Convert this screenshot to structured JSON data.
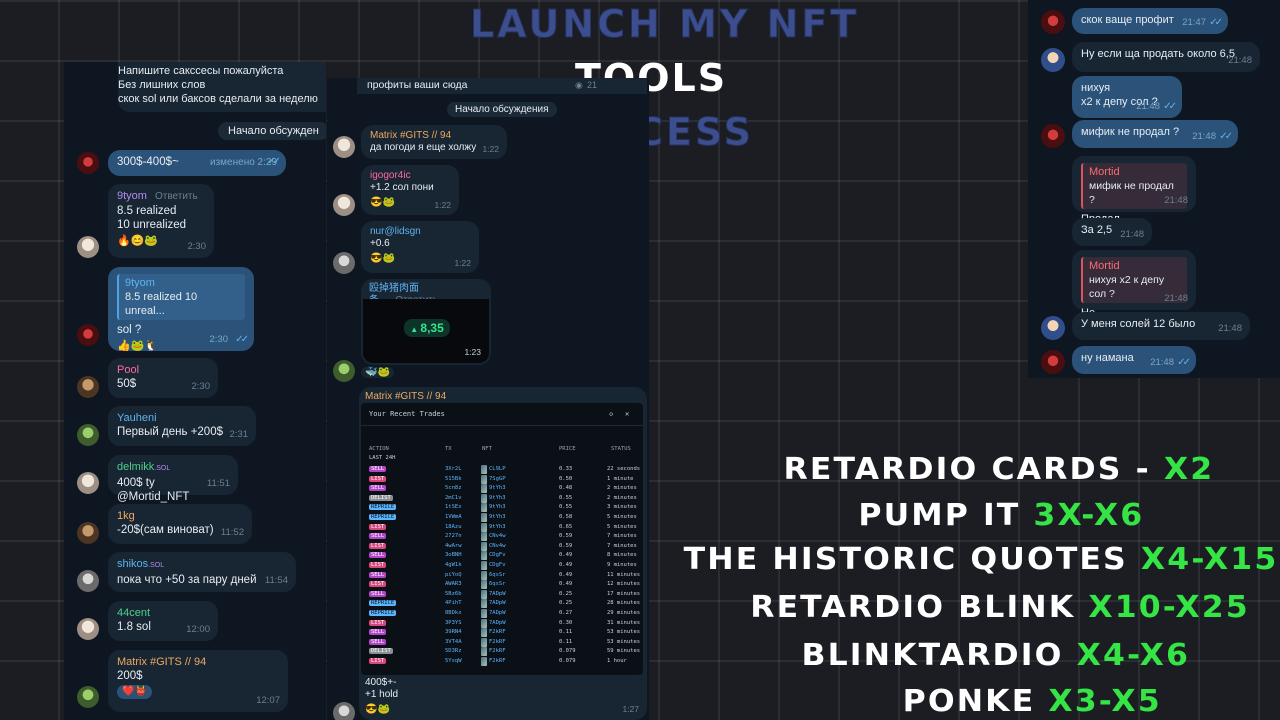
{
  "titles": {
    "line1": "Launch my NFT",
    "line2": "Tools",
    "line3": "Success"
  },
  "colors": {
    "accent_green": "#35e545",
    "bubble_in": "#182533",
    "bubble_out": "#2b5278",
    "title_blue": "#3d4e8e"
  },
  "left_chat": {
    "pinned_lines": [
      "Напишите сакссесы пожалуйста",
      "Без лишних слов",
      "скок sol или баксов сделали за неделю"
    ],
    "discussion_label": "Начало обсужден",
    "messages": [
      {
        "sender": "",
        "text": "300$-400$~",
        "edited": "изменено 2:29",
        "time": ""
      },
      {
        "sender": "9tyom",
        "reply": "Ответить",
        "text1": "8.5 realized",
        "text2": "10 unrealized",
        "emoji": "🔥😊🐸",
        "time": "2:30"
      },
      {
        "quote_name": "9tyom",
        "quote_text": "8.5 realized 10 unreal...",
        "text": "sol ?",
        "emoji": "👍🐸🐧",
        "time": "2:30"
      },
      {
        "sender": "Pool",
        "text": "50$",
        "time": "2:30"
      },
      {
        "sender": "Yauheni",
        "text": "Первый день +200$",
        "time": "2:31"
      },
      {
        "sender": "delmikk",
        "badge": ".SOL",
        "text": "400$ ty @Mortid_NFT",
        "time": "11:51"
      },
      {
        "sender": "1kg",
        "text": "-20$(сам виноват)",
        "time": "11:52"
      },
      {
        "sender": "shikos",
        "badge": ".SOL",
        "text": "пока что +50 за пару дней",
        "time": "11:54"
      },
      {
        "sender": "44cent",
        "text": "1.8 sol",
        "time": "12:00"
      },
      {
        "sender": "Matrix #GITS // 94",
        "text": "200$",
        "emoji": "❤️👹",
        "time": "12:07"
      }
    ]
  },
  "mid_chat": {
    "top_text": "профиты ваши сюда",
    "views": "21",
    "discussion_label": "Начало обсуждения",
    "messages": [
      {
        "sender": "Matrix #GITS // 94",
        "text": "да погоди я еще холжу",
        "time": "1:22"
      },
      {
        "sender": "igogor4ic",
        "text": "+1.2 сол пони",
        "emoji": "😎🐸",
        "time": "1:22"
      },
      {
        "sender": "nur@lidsgn",
        "text": "+0.6",
        "emoji": "😎🐸",
        "time": "1:22"
      },
      {
        "sender": "殴掉猪肉面条...",
        "reply": "Ответить",
        "value": "8,35",
        "time": "1:23"
      },
      {
        "emoji": "🐳🐸"
      },
      {
        "sender": "Matrix #GITS // 94",
        "text1": "400$+-",
        "text2": "+1 hold",
        "emoji": "😎🐸",
        "time": "1:27"
      }
    ]
  },
  "trades": {
    "title": "Your Recent Trades",
    "columns": [
      "ACTION",
      "TX",
      "NFT",
      "PRICE",
      "STATUS"
    ],
    "period": "LAST 24H",
    "rows": [
      {
        "action": "SELL",
        "tx": "3Xr2L",
        "nft": "CL9LP",
        "price": "0.33",
        "status": "22 seconds"
      },
      {
        "action": "LIST",
        "tx": "515Bk",
        "nft": "7SgGP",
        "price": "0.50",
        "status": "1 minute"
      },
      {
        "action": "SELL",
        "tx": "5cn8z",
        "nft": "9tYh3",
        "price": "0.48",
        "status": "2 minutes"
      },
      {
        "action": "DELIST",
        "tx": "2mC1v",
        "nft": "9tYh3",
        "price": "0.55",
        "status": "2 minutes"
      },
      {
        "action": "REPRICE",
        "tx": "1tSEx",
        "nft": "9tYh3",
        "price": "0.55",
        "status": "3 minutes"
      },
      {
        "action": "REPRICE",
        "tx": "1VWmA",
        "nft": "9tYh3",
        "price": "0.58",
        "status": "5 minutes"
      },
      {
        "action": "LIST",
        "tx": "18Azu",
        "nft": "9tYh3",
        "price": "0.65",
        "status": "5 minutes"
      },
      {
        "action": "SELL",
        "tx": "2727n",
        "nft": "CNv4w",
        "price": "0.59",
        "status": "7 minutes"
      },
      {
        "action": "LIST",
        "tx": "4wArw",
        "nft": "CNv4w",
        "price": "0.59",
        "status": "7 minutes"
      },
      {
        "action": "SELL",
        "tx": "3oBNH",
        "nft": "CDgFv",
        "price": "0.49",
        "status": "8 minutes"
      },
      {
        "action": "LIST",
        "tx": "4gW1k",
        "nft": "CDgFv",
        "price": "0.49",
        "status": "9 minutes"
      },
      {
        "action": "SELL",
        "tx": "piYoQ",
        "nft": "6qsSr",
        "price": "0.49",
        "status": "11 minutes"
      },
      {
        "action": "LIST",
        "tx": "AWAR3",
        "nft": "6qsSr",
        "price": "0.49",
        "status": "12 minutes"
      },
      {
        "action": "SELL",
        "tx": "5Bz6b",
        "nft": "7ADpW",
        "price": "0.25",
        "status": "17 minutes"
      },
      {
        "action": "REPRICE",
        "tx": "4PihT",
        "nft": "7ADpW",
        "price": "0.25",
        "status": "28 minutes"
      },
      {
        "action": "REPRICE",
        "tx": "8BDkx",
        "nft": "7ADpW",
        "price": "0.27",
        "status": "29 minutes"
      },
      {
        "action": "LIST",
        "tx": "3P3YS",
        "nft": "7ADpW",
        "price": "0.30",
        "status": "31 minutes"
      },
      {
        "action": "SELL",
        "tx": "39RN4",
        "nft": "F2kRF",
        "price": "0.11",
        "status": "53 minutes"
      },
      {
        "action": "SELL",
        "tx": "3VT4A",
        "nft": "F2kRF",
        "price": "0.11",
        "status": "53 minutes"
      },
      {
        "action": "DELIST",
        "tx": "5D3Rz",
        "nft": "F2kRF",
        "price": "0.079",
        "status": "59 minutes"
      },
      {
        "action": "LIST",
        "tx": "5YsqW",
        "nft": "F2kRF",
        "price": "0.079",
        "status": "1 hour"
      }
    ]
  },
  "right_chat": {
    "messages": [
      {
        "text": "скок ваще профит",
        "time": "21:47"
      },
      {
        "text": "Ну если ща продать около 6,5",
        "time": "21:48"
      },
      {
        "text1": "нихуя",
        "text2": "x2 к депу сол ?",
        "time": "21:48"
      },
      {
        "text": "мифик не продал ?",
        "time": "21:48"
      },
      {
        "quote_name": "Mortid",
        "quote_text": "мифик не продал ?",
        "text": "Продал",
        "time": "21:48"
      },
      {
        "text": "За 2,5",
        "time": "21:48"
      },
      {
        "quote_name": "Mortid",
        "quote_text": "нихуя x2 к депу сол ?",
        "text": "Не",
        "time": "21:48"
      },
      {
        "text": "У меня солей 12 было",
        "time": "21:48"
      },
      {
        "text": "ну намана",
        "time": "21:48"
      }
    ]
  },
  "promo": [
    {
      "name": "Retardio cards - ",
      "mult": "x2"
    },
    {
      "name": "Pump it ",
      "mult": "3x-x6"
    },
    {
      "name": "The Historic quotes ",
      "mult": "x4-x15"
    },
    {
      "name": "Retardio blink ",
      "mult": "x10-x25"
    },
    {
      "name": "Blinktardio ",
      "mult": "x4-x6"
    },
    {
      "name": "Ponke ",
      "mult": "x3-x5"
    }
  ]
}
